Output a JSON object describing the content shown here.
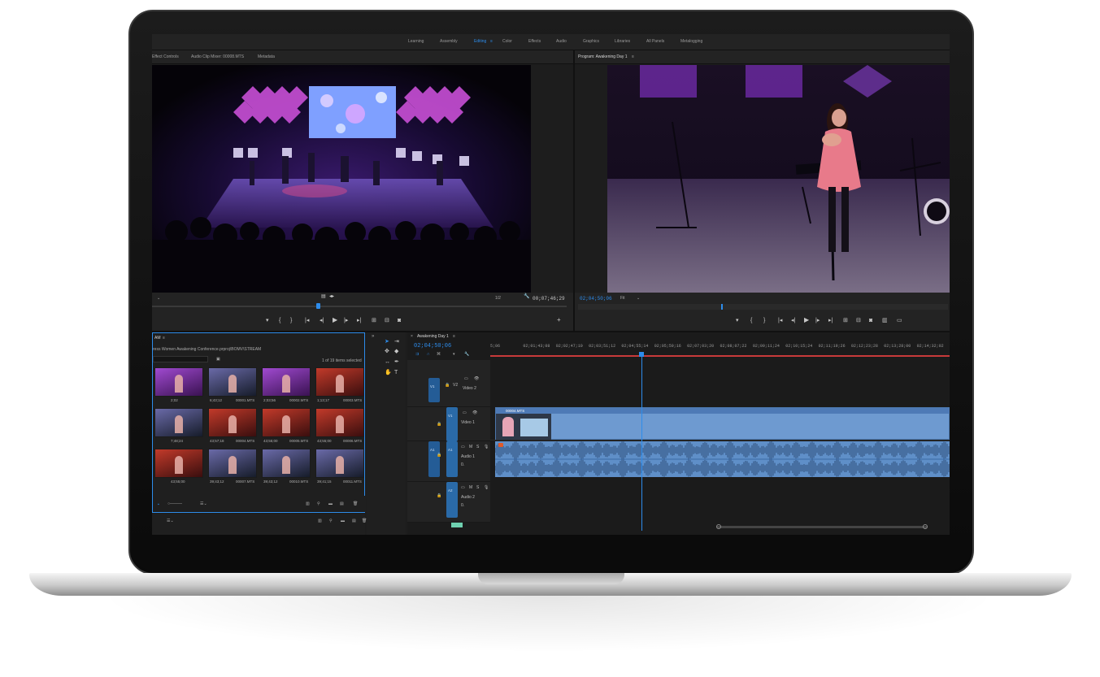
{
  "workspace_tabs": [
    {
      "label": "Learning",
      "active": false
    },
    {
      "label": "Assembly",
      "active": false
    },
    {
      "label": "Editing",
      "active": true
    },
    {
      "label": "Color",
      "active": false
    },
    {
      "label": "Effects",
      "active": false
    },
    {
      "label": "Audio",
      "active": false
    },
    {
      "label": "Graphics",
      "active": false
    },
    {
      "label": "Libraries",
      "active": false
    },
    {
      "label": "All Panels",
      "active": false
    },
    {
      "label": "Metalogging",
      "active": false
    }
  ],
  "source_panel": {
    "tabs": [
      "Effect Controls",
      "Audio Clip Mixer: 00008.MTS",
      "Metadata"
    ],
    "zoom": "1/2",
    "timecode": "00;07;46;29"
  },
  "program_panel": {
    "title": "Program: Awakening Day 1",
    "timecode": "02;04;50;06",
    "fit": "Fit"
  },
  "project_panel": {
    "title": "AM",
    "path": "ress Women Awakening Conference.prproj\\BOMV\\STREAM",
    "selection": "1 of 19 items selected",
    "items": [
      {
        "name": "",
        "duration": "2;02",
        "tone": "purple"
      },
      {
        "name": "00001.MTS",
        "duration": "6;43;12",
        "tone": "stage"
      },
      {
        "name": "00002.MTS",
        "duration": "2;03;56",
        "tone": "purple"
      },
      {
        "name": "00003.MTS",
        "duration": "1;13;17",
        "tone": "red"
      },
      {
        "name": "",
        "duration": "7;48;24",
        "tone": "stage"
      },
      {
        "name": "00004.MTS",
        "duration": "43;57;18",
        "tone": "red"
      },
      {
        "name": "00005.MTS",
        "duration": "43;55;00",
        "tone": "red"
      },
      {
        "name": "00006.MTS",
        "duration": "43;55;00",
        "tone": "red"
      },
      {
        "name": "",
        "duration": "43;55;00",
        "tone": "red"
      },
      {
        "name": "00007.MTS",
        "duration": "39;43;12",
        "tone": "stage"
      },
      {
        "name": "00010.MTS",
        "duration": "39;43;12",
        "tone": "stage"
      },
      {
        "name": "00011.MTS",
        "duration": "39;41;15",
        "tone": "stage"
      }
    ]
  },
  "timeline": {
    "tab": "Awakening Day 1",
    "timecode": "02;04;50;06",
    "ruler": [
      "5;06",
      "02;01;43;08",
      "02;02;47;10",
      "02;03;51;12",
      "02;04;55;14",
      "02;05;59;16",
      "02;07;03;20",
      "02;08;07;22",
      "02;09;11;24",
      "02;10;15;24",
      "02;11;19;26",
      "02;12;23;28",
      "02;13;28;00",
      "02;14;32;02"
    ],
    "playhead_fraction": 0.33,
    "tracks": [
      {
        "target": "V1",
        "id": "V2",
        "name": "Video 2"
      },
      {
        "target": "",
        "id": "V1",
        "name": "Video 1"
      },
      {
        "target": "A1",
        "id": "A1",
        "name": "Audio 1"
      },
      {
        "target": "A2",
        "id": "A2",
        "name": "Audio 2"
      }
    ],
    "clip_label": "00004.MTS",
    "audio_level": "0.",
    "audio_mode": "M",
    "solo": "S"
  },
  "colors": {
    "accent": "#2d8ceb",
    "clip_video": "#6e9ad0",
    "clip_audio": "#5f8fc8",
    "playhead": "#2d8ceb",
    "work_area": "#c83a3a"
  }
}
